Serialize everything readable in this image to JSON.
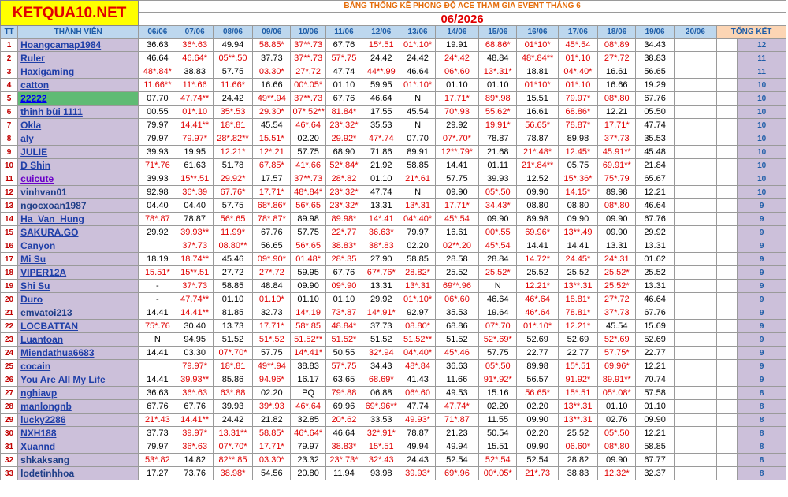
{
  "logo": "KETQUA10.NET",
  "title": "BẢNG THỐNG KÊ PHONG ĐỘ ACE THAM GIA EVENT THÁNG 6",
  "month": "06/2026",
  "headers": {
    "tt": "TT",
    "member": "THÀNH VIÊN",
    "dates": [
      "06/06",
      "07/06",
      "08/06",
      "09/06",
      "10/06",
      "11/06",
      "12/06",
      "13/06",
      "14/06",
      "15/06",
      "16/06",
      "17/06",
      "18/06",
      "19/06",
      "20/06"
    ],
    "total": "TỔNG KẾT"
  },
  "rows": [
    {
      "tt": "1",
      "name": "Hoangcamap1984",
      "style": "",
      "cells": [
        "36.63",
        "36*.63",
        "49.94",
        "58.85*",
        "37**.73",
        "67.76",
        "15*.51",
        "01*.10*",
        "19.91",
        "68.86*",
        "01*10*",
        "45*.54",
        "08*.89",
        "34.43",
        ""
      ],
      "total": "12"
    },
    {
      "tt": "2",
      "name": "Ruler",
      "style": "",
      "cells": [
        "46.64",
        "46.64*",
        "05**.50",
        "37.73",
        "37**.73",
        "57*.75",
        "24.42",
        "24.42",
        "24*.42",
        "48.84",
        "48*.84**",
        "01*.10",
        "27*.72",
        "38.83",
        ""
      ],
      "total": "11"
    },
    {
      "tt": "3",
      "name": "Haxigaming",
      "style": "",
      "cells": [
        "48*.84*",
        "38.83",
        "57.75",
        "03.30*",
        "27*.72",
        "47.74",
        "44**.99",
        "46.64",
        "06*.60",
        "13*.31*",
        "18.81",
        "04*.40*",
        "16.61",
        "56.65",
        ""
      ],
      "total": "11"
    },
    {
      "tt": "4",
      "name": "catton",
      "style": "",
      "cells": [
        "11.66**",
        "11*.66",
        "11.66*",
        "16.66",
        "00*.05*",
        "01.10",
        "59.95",
        "01*.10*",
        "01.10",
        "01.10",
        "01*10*",
        "01*.10",
        "16.66",
        "19.29",
        ""
      ],
      "total": "10"
    },
    {
      "tt": "5",
      "name": "22222",
      "style": "hl",
      "cells": [
        "07.70",
        "47.74**",
        "24.42",
        "49**.94",
        "37**.73",
        "67.76",
        "46.64",
        "N",
        "17.71*",
        "89*.98",
        "15.51",
        "79.97*",
        "08*.80",
        "67.76",
        ""
      ],
      "total": "10"
    },
    {
      "tt": "6",
      "name": "thinh bùi 1111",
      "style": "",
      "cells": [
        "00.55",
        "01*.10",
        "35*.53",
        "29.30*",
        "07*.52**",
        "81.84*",
        "17.55",
        "45.54",
        "70*.93",
        "55.62*",
        "16.61",
        "68.86*",
        "12.21",
        "05.50",
        ""
      ],
      "total": "10"
    },
    {
      "tt": "7",
      "name": "Okla",
      "style": "",
      "cells": [
        "79.97",
        "14.41**",
        "18*.81",
        "45.54",
        "46*.64",
        "23*.32*",
        "35.53",
        "N",
        "29.92",
        "19.91*",
        "56.65*",
        "78.87*",
        "17.71*",
        "47.74",
        ""
      ],
      "total": "10"
    },
    {
      "tt": "8",
      "name": "aly",
      "style": "",
      "cells": [
        "79.97",
        "79.97*",
        "28*.82**",
        "15.51*",
        "02.20",
        "29.92*",
        "47*.74",
        "07.70",
        "07*.70*",
        "78.87",
        "78.87",
        "89.98",
        "37*.73",
        "35.53",
        ""
      ],
      "total": "10"
    },
    {
      "tt": "9",
      "name": "JULIE",
      "style": "",
      "cells": [
        "39.93",
        "19.95",
        "12.21*",
        "12*.21",
        "57.75",
        "68.90",
        "71.86",
        "89.91",
        "12**.79*",
        "21.68",
        "21*.48*",
        "12.45*",
        "45.91**",
        "45.48",
        ""
      ],
      "total": "10"
    },
    {
      "tt": "10",
      "name": "D Shin",
      "style": "",
      "cells": [
        "71*.76",
        "61.63",
        "51.78",
        "67.85*",
        "41*.66",
        "52*.84*",
        "21.92",
        "58.85",
        "14.41",
        "01.11",
        "21*.84**",
        "05.75",
        "69.91**",
        "21.84",
        ""
      ],
      "total": "10"
    },
    {
      "tt": "11",
      "name": "cuicute",
      "style": "purple",
      "cells": [
        "39.93",
        "15**.51",
        "29.92*",
        "17.57",
        "37**.73",
        "28*.82",
        "01.10",
        "21*.61",
        "57.75",
        "39.93",
        "12.52",
        "15*.36*",
        "75*.79",
        "65.67",
        ""
      ],
      "total": "10"
    },
    {
      "tt": "12",
      "name": "vinhvan01",
      "style": "plain",
      "cells": [
        "92.98",
        "36*.39",
        "67.76*",
        "17.71*",
        "48*.84*",
        "23*.32*",
        "47.74",
        "N",
        "09.90",
        "05*.50",
        "09.90",
        "14.15*",
        "89.98",
        "12.21",
        ""
      ],
      "total": "10"
    },
    {
      "tt": "13",
      "name": "ngocxoan1987",
      "style": "plain",
      "cells": [
        "04.40",
        "04.40",
        "57.75",
        "68*.86*",
        "56*.65",
        "23*.32*",
        "13.31",
        "13*.31",
        "17.71*",
        "34.43*",
        "08.80",
        "08.80",
        "08*.80",
        "46.64",
        ""
      ],
      "total": "9"
    },
    {
      "tt": "14",
      "name": "Ha_Van_Hung",
      "style": "",
      "cells": [
        "78*.87",
        "78.87",
        "56*.65",
        "78*.87*",
        "89.98",
        "89.98*",
        "14*.41",
        "04*.40*",
        "45*.54",
        "09.90",
        "89.98",
        "09.90",
        "09.90",
        "67.76",
        ""
      ],
      "total": "9"
    },
    {
      "tt": "15",
      "name": "SAKURA.GO",
      "style": "",
      "cells": [
        "29.92",
        "39.93**",
        "11.99*",
        "67.76",
        "57.75",
        "22*.77",
        "36.63*",
        "79.97",
        "16.61",
        "00*.55",
        "69.96*",
        "13**.49",
        "09.90",
        "29.92",
        ""
      ],
      "total": "9"
    },
    {
      "tt": "16",
      "name": "Canyon",
      "style": "",
      "cells": [
        "",
        "37*.73",
        "08.80**",
        "56.65",
        "56*.65",
        "38.83*",
        "38*.83",
        "02.20",
        "02**.20",
        "45*.54",
        "14.41",
        "14.41",
        "13.31",
        "13.31",
        ""
      ],
      "total": "9"
    },
    {
      "tt": "17",
      "name": "Mi Su",
      "style": "",
      "cells": [
        "18.19",
        "18.74**",
        "45.46",
        "09*.90*",
        "01.48*",
        "28*.35",
        "27.90",
        "58.85",
        "28.58",
        "28.84",
        "14.72*",
        "24.45*",
        "24*.31",
        "01.62",
        ""
      ],
      "total": "9"
    },
    {
      "tt": "18",
      "name": "VIPER12A",
      "style": "",
      "cells": [
        "15.51*",
        "15**.51",
        "27.72",
        "27*.72",
        "59.95",
        "67.76",
        "67*.76*",
        "28.82*",
        "25.52",
        "25.52*",
        "25.52",
        "25.52",
        "25.52*",
        "25.52",
        ""
      ],
      "total": "9"
    },
    {
      "tt": "19",
      "name": "Shi Su",
      "style": "",
      "cells": [
        "-",
        "37*.73",
        "58.85",
        "48.84",
        "09.90",
        "09*.90",
        "13.31",
        "13*.31",
        "69**.96",
        "N",
        "12.21*",
        "13**.31",
        "25.52*",
        "13.31",
        ""
      ],
      "total": "9"
    },
    {
      "tt": "20",
      "name": "Duro",
      "style": "",
      "cells": [
        "-",
        "47.74**",
        "01.10",
        "01.10*",
        "01.10",
        "01.10",
        "29.92",
        "01*.10*",
        "06*.60",
        "46.64",
        "46*.64",
        "18.81*",
        "27*.72",
        "46.64",
        ""
      ],
      "total": "9"
    },
    {
      "tt": "21",
      "name": "emvatoi213",
      "style": "plain",
      "cells": [
        "14.41",
        "14.41**",
        "81.85",
        "32.73",
        "14*.19",
        "73*.87",
        "14*.91*",
        "92.97",
        "35.53",
        "19.64",
        "46*.64",
        "78.81*",
        "37*.73",
        "67.76",
        ""
      ],
      "total": "9"
    },
    {
      "tt": "22",
      "name": "LOCBATTAN",
      "style": "",
      "cells": [
        "75*.76",
        "30.40",
        "13.73",
        "17.71*",
        "58*.85",
        "48.84*",
        "37.73",
        "08.80*",
        "68.86",
        "07*.70",
        "01*.10*",
        "12.21*",
        "45.54",
        "15.69",
        ""
      ],
      "total": "9"
    },
    {
      "tt": "23",
      "name": "Luantoan",
      "style": "",
      "cells": [
        "N",
        "94.95",
        "51.52",
        "51*.52",
        "51.52**",
        "51.52*",
        "51.52",
        "51.52**",
        "51.52",
        "52*.69*",
        "52.69",
        "52.69",
        "52*.69",
        "52.69",
        ""
      ],
      "total": "9"
    },
    {
      "tt": "24",
      "name": "Miendathua6683",
      "style": "",
      "cells": [
        "14.41",
        "03.30",
        "07*.70*",
        "57.75",
        "14*.41*",
        "50.55",
        "32*.94",
        "04*.40*",
        "45*.46",
        "57.75",
        "22.77",
        "22.77",
        "57.75*",
        "22.77",
        ""
      ],
      "total": "9"
    },
    {
      "tt": "25",
      "name": "cocain",
      "style": "",
      "cells": [
        "",
        "79.97*",
        "18*.81",
        "49**.94",
        "38.83",
        "57*.75",
        "34.43",
        "48*.84",
        "36.63",
        "05*.50",
        "89.98",
        "15*.51",
        "69.96*",
        "12.21",
        ""
      ],
      "total": "9"
    },
    {
      "tt": "26",
      "name": "You Are All My Life",
      "style": "",
      "cells": [
        "14.41",
        "39.93**",
        "85.86",
        "94.96*",
        "16.17",
        "63.65",
        "68.69*",
        "41.43",
        "11.66",
        "91*.92*",
        "56.57",
        "91.92*",
        "89.91**",
        "70.74",
        ""
      ],
      "total": "9"
    },
    {
      "tt": "27",
      "name": "nghiavp",
      "style": "",
      "cells": [
        "36.63",
        "36*.63",
        "63*.88",
        "02.20",
        "PQ",
        "79*.88",
        "06.88",
        "06*.60",
        "49.53",
        "15.16",
        "56.65*",
        "15*.51",
        "05*.08*",
        "57.58",
        ""
      ],
      "total": "8"
    },
    {
      "tt": "28",
      "name": "manlongnb",
      "style": "",
      "cells": [
        "67.76",
        "67.76",
        "39.93",
        "39*.93",
        "46*.64",
        "69.96",
        "69*.96**",
        "47.74",
        "47.74*",
        "02.20",
        "02.20",
        "13**.31",
        "01.10",
        "01.10",
        ""
      ],
      "total": "8"
    },
    {
      "tt": "29",
      "name": "lucky2286",
      "style": "",
      "cells": [
        "21*.43",
        "14.41**",
        "24.42",
        "21.82",
        "32.85",
        "20*.62",
        "33.53",
        "49.93*",
        "71*.87",
        "11.55",
        "09.90",
        "13**.31",
        "02.76",
        "09.90",
        ""
      ],
      "total": "8"
    },
    {
      "tt": "30",
      "name": "NXH188",
      "style": "",
      "cells": [
        "37.73",
        "39.97*",
        "13.31**",
        "58.85*",
        "46*.64*",
        "46.64",
        "32*.91*",
        "78.87",
        "21.23",
        "50.54",
        "02.20",
        "25.52",
        "05*.50",
        "12.21",
        ""
      ],
      "total": "8"
    },
    {
      "tt": "31",
      "name": "Xuannd",
      "style": "",
      "cells": [
        "79.97",
        "36*.63",
        "07*.70*",
        "17.71*",
        "79.97",
        "38.83*",
        "15*.51",
        "49.94",
        "49.94",
        "15.51",
        "09.90",
        "06.60*",
        "08*.80",
        "58.85",
        ""
      ],
      "total": "8"
    },
    {
      "tt": "32",
      "name": "shkaksang",
      "style": "plain",
      "cells": [
        "53*.82",
        "14.82",
        "82**.85",
        "03.30*",
        "23.32",
        "23*.73*",
        "32*.43",
        "24.43",
        "52.54",
        "52*.54",
        "52.54",
        "28.82",
        "09.90",
        "67.77",
        ""
      ],
      "total": "8"
    },
    {
      "tt": "33",
      "name": "lodetinhhoa",
      "style": "plain",
      "cells": [
        "17.27",
        "73.76",
        "38.98*",
        "54.56",
        "20.80",
        "11.94",
        "93.98",
        "39.93*",
        "69*.96",
        "00*.05*",
        "21*.73",
        "38.83",
        "12.32*",
        "32.37",
        ""
      ],
      "total": "8"
    }
  ]
}
